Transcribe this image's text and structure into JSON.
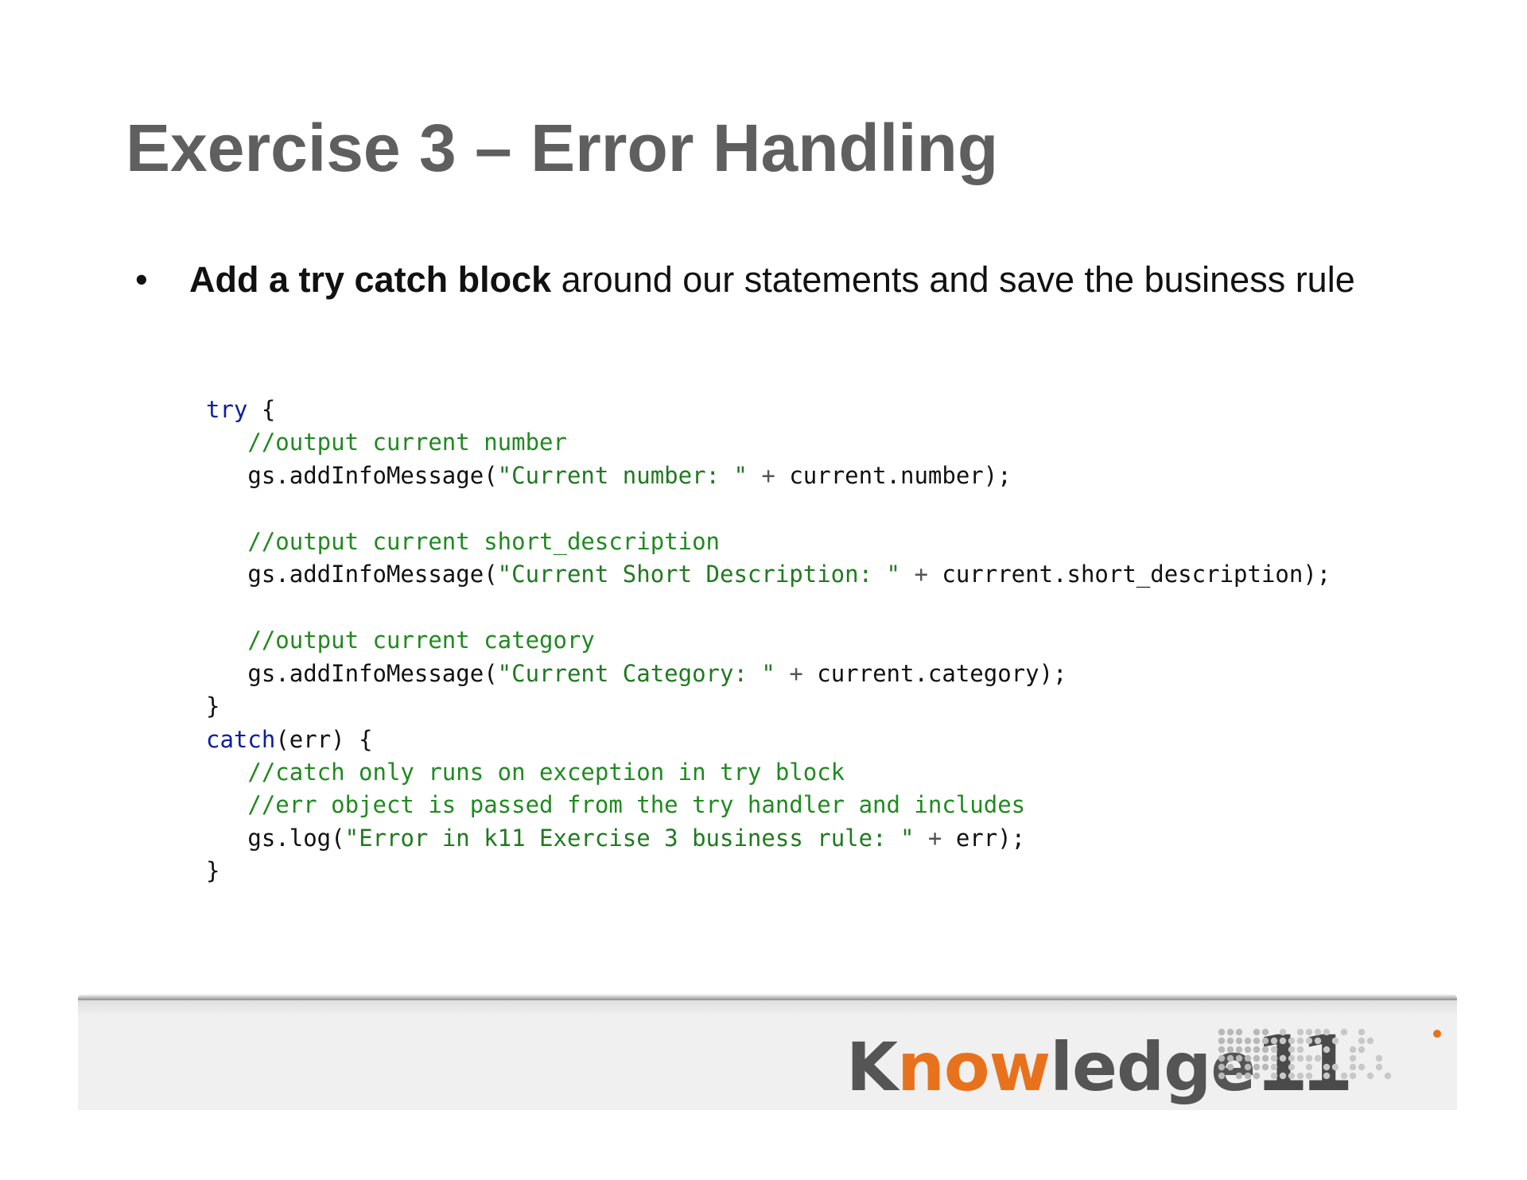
{
  "title": "Exercise 3 – Error Handling",
  "bullet": {
    "marker": "•",
    "bold": "Add a try catch block",
    "rest": " around our statements and save the business rule"
  },
  "code": {
    "lines": [
      [
        {
          "t": "try",
          "c": "kw"
        },
        {
          "t": " {",
          "c": ""
        }
      ],
      [
        {
          "t": "   //output current number",
          "c": "cm"
        }
      ],
      [
        {
          "t": "   gs.addInfoMessage(",
          "c": ""
        },
        {
          "t": "\"Current number: \"",
          "c": "st"
        },
        {
          "t": " + ",
          "c": "op"
        },
        {
          "t": "current.number);",
          "c": ""
        }
      ],
      [],
      [
        {
          "t": "   //output current short_description",
          "c": "cm"
        }
      ],
      [
        {
          "t": "   gs.addInfoMessage(",
          "c": ""
        },
        {
          "t": "\"Current Short Description: \"",
          "c": "st"
        },
        {
          "t": " + ",
          "c": "op"
        },
        {
          "t": "currrent.short_description);",
          "c": ""
        }
      ],
      [],
      [
        {
          "t": "   //output current category",
          "c": "cm"
        }
      ],
      [
        {
          "t": "   gs.addInfoMessage(",
          "c": ""
        },
        {
          "t": "\"Current Category: \"",
          "c": "st"
        },
        {
          "t": " + ",
          "c": "op"
        },
        {
          "t": "current.category);",
          "c": ""
        }
      ],
      [
        {
          "t": "}",
          "c": ""
        }
      ],
      [
        {
          "t": "catch",
          "c": "kw"
        },
        {
          "t": "(err) {",
          "c": ""
        }
      ],
      [
        {
          "t": "   //catch only runs on exception in try block",
          "c": "cm"
        }
      ],
      [
        {
          "t": "   //err object is passed from the try handler and includes",
          "c": "cm"
        }
      ],
      [
        {
          "t": "   gs.log(",
          "c": ""
        },
        {
          "t": "\"Error in k11 Exercise 3 business rule: \"",
          "c": "st"
        },
        {
          "t": " + ",
          "c": "op"
        },
        {
          "t": "err);",
          "c": ""
        }
      ],
      [
        {
          "t": "}",
          "c": ""
        }
      ]
    ]
  },
  "logo": {
    "k": "K",
    "now": "now",
    "ledge": "ledge",
    "num": "11",
    "accent": "#e8721c"
  }
}
